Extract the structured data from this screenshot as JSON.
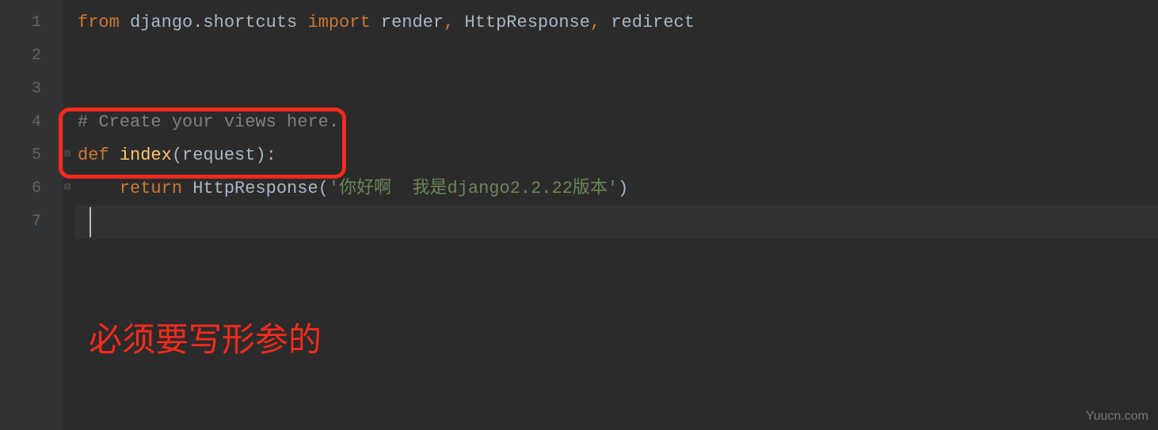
{
  "gutter": {
    "lines": [
      "1",
      "2",
      "3",
      "4",
      "5",
      "6",
      "7"
    ]
  },
  "code": {
    "line1": {
      "kw1": "from",
      "mod": " django.shortcuts ",
      "kw2": "import",
      "names": " render",
      "comma1": ", ",
      "http": "HttpResponse",
      "comma2": ", ",
      "redir": "redirect"
    },
    "line4": {
      "comment": "# Create your views here."
    },
    "line5": {
      "kw": "def ",
      "fn": "index",
      "params": "(request):"
    },
    "line6": {
      "indent": "    ",
      "kw": "return ",
      "call": "HttpResponse(",
      "str": "'你好啊  我是django2.2.22版本'",
      "close": ")"
    }
  },
  "annotation": {
    "text": "必须要写形参的"
  },
  "watermark": "Yuucn.com"
}
